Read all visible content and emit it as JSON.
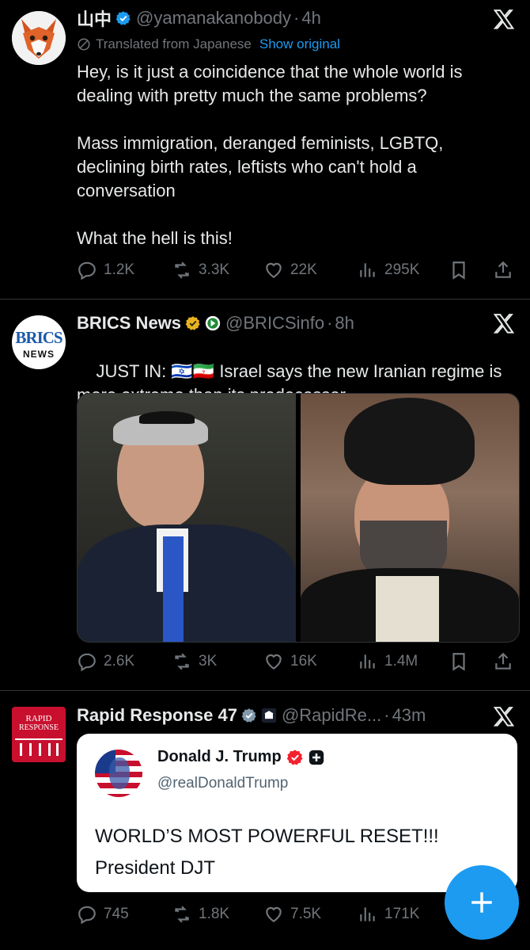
{
  "tweets": [
    {
      "name": "山中",
      "handle": "@yamanakanobody",
      "sep": "·",
      "time": "4h",
      "translated_label": "Translated from Japanese",
      "show_original": "Show original",
      "text": "Hey, is it just a coincidence that the whole world is dealing with pretty much the same problems?\n\nMass immigration, deranged feminists, LGBTQ, declining birth rates, leftists who can't hold a conversation\n\nWhat the hell is this!",
      "replies": "1.2K",
      "reposts": "3.3K",
      "likes": "22K",
      "views": "295K"
    },
    {
      "name": "BRICS News",
      "handle": "@BRICSinfo",
      "sep": "·",
      "time": "8h",
      "logo_text_top": "BRICS",
      "logo_text_bottom": "NEWS",
      "text_prefix": "JUST IN: ",
      "text_flags": "🇮🇱🇮🇷",
      "text": " Israel says the new Iranian regime is more extreme than its predecessor.",
      "replies": "2.6K",
      "reposts": "3K",
      "likes": "16K",
      "views": "1.4M"
    },
    {
      "name": "Rapid Response 47",
      "handle": "@RapidRe...",
      "sep": "·",
      "time": "43m",
      "logo_text_top": "RAPID",
      "logo_text_bottom": "RESPONSE",
      "quote": {
        "name": "Donald J. Trump",
        "handle": "@realDonaldTrump",
        "text": "WORLD’S MOST POWERFUL RESET!!!\nPresident DJT"
      },
      "replies": "745",
      "reposts": "1.8K",
      "likes": "7.5K",
      "views": "171K"
    }
  ],
  "colors": {
    "background": "#000000",
    "text": "#e7e9ea",
    "muted": "#71767b",
    "accent": "#1d9bf0",
    "verified_gold": "#e8b31e"
  },
  "fab": {
    "icon": "plus-icon"
  }
}
